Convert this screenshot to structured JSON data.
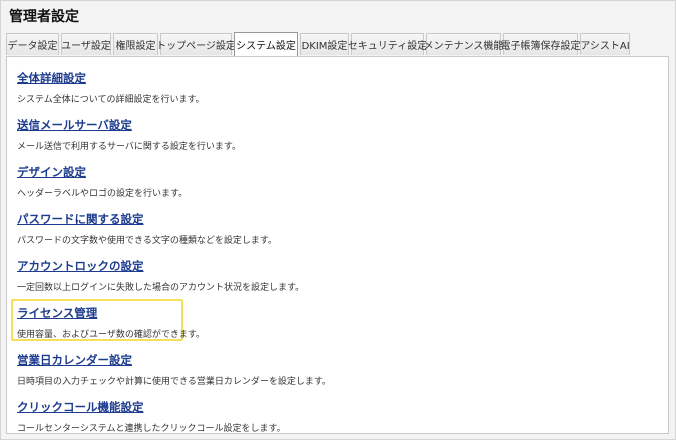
{
  "page": {
    "title": "管理者設定"
  },
  "tabs": [
    {
      "label": "データ設定"
    },
    {
      "label": "ユーザ設定"
    },
    {
      "label": "権限設定"
    },
    {
      "label": "トップページ設定"
    },
    {
      "label": "システム設定",
      "active": true
    },
    {
      "label": "DKIM設定"
    },
    {
      "label": "セキュリティ設定"
    },
    {
      "label": "メンテナンス機能"
    },
    {
      "label": "電子帳簿保存設定"
    },
    {
      "label": "アシストAI"
    }
  ],
  "items": [
    {
      "title": "全体詳細設定",
      "description": "システム全体についての詳細設定を行います。"
    },
    {
      "title": "送信メールサーバ設定",
      "description": "メール送信で利用するサーバに関する設定を行います。"
    },
    {
      "title": "デザイン設定",
      "description": "ヘッダーラベルやロゴの設定を行います。"
    },
    {
      "title": "パスワードに関する設定",
      "description": "パスワードの文字数や使用できる文字の種類などを設定します。"
    },
    {
      "title": "アカウントロックの設定",
      "description": "一定回数以上ログインに失敗した場合のアカウント状況を設定します。"
    },
    {
      "title": "ライセンス管理",
      "description": "使用容量、およびユーザ数の確認ができます。"
    },
    {
      "title": "営業日カレンダー設定",
      "description": "日時項目の入力チェックや計算に使用できる営業日カレンダーを設定します。"
    },
    {
      "title": "クリックコール機能設定",
      "description": "コールセンターシステムと連携したクリックコール設定をします。"
    }
  ],
  "colors": {
    "link": "#1d3c8f",
    "highlight": "#f4e05a"
  }
}
